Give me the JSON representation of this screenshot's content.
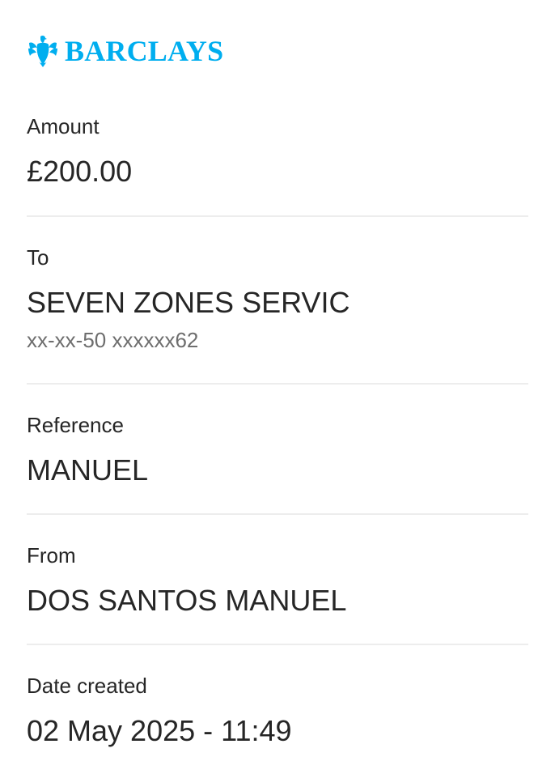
{
  "brand": {
    "name": "BARCLAYS",
    "color": "#00aeef",
    "icon": "eagle-icon"
  },
  "amount": {
    "label": "Amount",
    "value": "£200.00"
  },
  "to": {
    "label": "To",
    "name": "SEVEN ZONES SERVIC",
    "account": "xx-xx-50 xxxxxx62"
  },
  "reference": {
    "label": "Reference",
    "value": "MANUEL"
  },
  "from": {
    "label": "From",
    "value": "DOS SANTOS MANUEL"
  },
  "date_created": {
    "label": "Date created",
    "value": "02 May 2025 - 11:49"
  }
}
